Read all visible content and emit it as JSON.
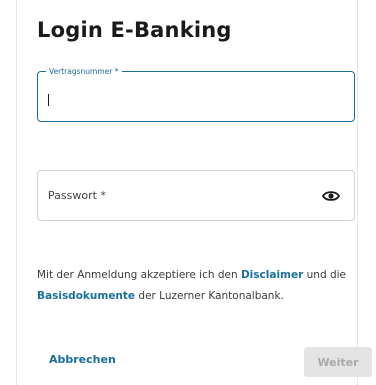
{
  "dialog": {
    "title": "Login E-Banking"
  },
  "contract_field": {
    "label": "Vertragsnummer *",
    "value": ""
  },
  "password_field": {
    "placeholder": "Passwort *",
    "toggle_icon": "eye-icon"
  },
  "disclaimer": {
    "text_before": "Mit der Anmeldung akzeptiere ich den ",
    "disclaimer_link": "Disclaimer",
    "text_middle": " und die ",
    "documents_link": "Basisdokumente",
    "text_after": " der Luzerner Kantonalbank."
  },
  "actions": {
    "cancel_label": "Abbrechen",
    "next_label": "Weiter"
  },
  "colors": {
    "accent": "#1a6f9a",
    "border": "#d2d2d2",
    "disabled_bg": "#e4e4e4",
    "disabled_text": "#a9a9a9"
  }
}
